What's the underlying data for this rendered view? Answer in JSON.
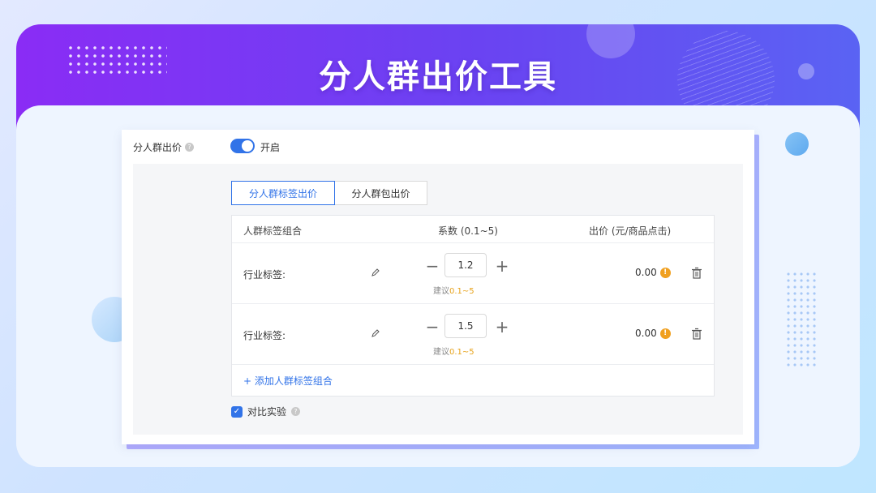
{
  "banner": {
    "title": "分人群出价工具"
  },
  "form": {
    "field_label": "分人群出价",
    "toggle_label": "开启",
    "toggle_on": true
  },
  "tabs": [
    {
      "label": "分人群标签出价",
      "active": true
    },
    {
      "label": "分人群包出价",
      "active": false
    }
  ],
  "table": {
    "headers": [
      "人群标签组合",
      "系数 (0.1~5)",
      "出价 (元/商品点击)"
    ],
    "rows": [
      {
        "label": "行业标签:",
        "coefficient": "1.2",
        "hint_prefix": "建议",
        "hint_range": "0.1~5",
        "price": "0.00"
      },
      {
        "label": "行业标签:",
        "coefficient": "1.5",
        "hint_prefix": "建议",
        "hint_range": "0.1~5",
        "price": "0.00"
      }
    ],
    "add_label": "+ 添加人群标签组合"
  },
  "compare": {
    "label": "对比实验",
    "checked": true
  },
  "colors": {
    "accent": "#3173e8",
    "warning": "#f0a020",
    "banner_start": "#8a2cf5",
    "banner_end": "#5a63f3"
  }
}
